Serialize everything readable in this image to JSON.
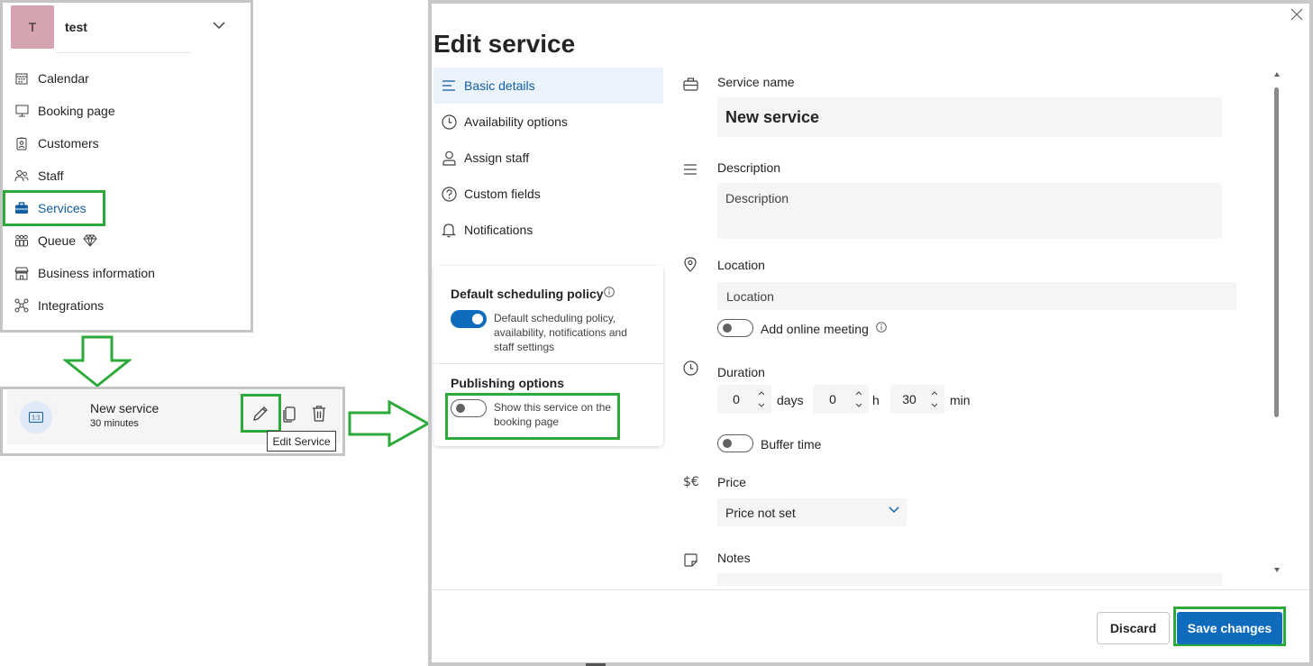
{
  "account": {
    "initial": "T",
    "name": "test"
  },
  "nav": {
    "items": [
      {
        "label": "Calendar",
        "icon": "calendar-icon"
      },
      {
        "label": "Booking page",
        "icon": "monitor-icon"
      },
      {
        "label": "Customers",
        "icon": "contact-card-icon"
      },
      {
        "label": "Staff",
        "icon": "people-icon"
      },
      {
        "label": "Services",
        "icon": "briefcase-icon",
        "active": true
      },
      {
        "label": "Queue",
        "icon": "queue-icon",
        "badge_icon": "diamond-icon"
      },
      {
        "label": "Business information",
        "icon": "building-icon"
      },
      {
        "label": "Integrations",
        "icon": "integrations-icon"
      }
    ]
  },
  "service_card": {
    "icon_text": "1:1",
    "title": "New service",
    "subtitle": "30 minutes",
    "tooltip": "Edit Service"
  },
  "dialog": {
    "title": "Edit service",
    "tabs": [
      {
        "label": "Basic details",
        "icon": "lines-icon",
        "active": true
      },
      {
        "label": "Availability options",
        "icon": "clock-icon"
      },
      {
        "label": "Assign staff",
        "icon": "person-icon"
      },
      {
        "label": "Custom fields",
        "icon": "question-icon"
      },
      {
        "label": "Notifications",
        "icon": "bell-icon"
      }
    ],
    "policy": {
      "title": "Default scheduling policy",
      "toggle_on": true,
      "text": "Default scheduling policy, availability, notifications and staff settings"
    },
    "publishing": {
      "title": "Publishing options",
      "toggle_on": false,
      "text": "Show this service on the booking page"
    },
    "form": {
      "service_name_label": "Service name",
      "service_name_value": "New service",
      "description_label": "Description",
      "description_placeholder": "Description",
      "location_label": "Location",
      "location_placeholder": "Location",
      "online_meeting_label": "Add online meeting",
      "online_meeting_on": false,
      "duration_label": "Duration",
      "duration_days": "0",
      "duration_days_unit": "days",
      "duration_hours": "0",
      "duration_hours_unit": "h",
      "duration_minutes": "30",
      "duration_minutes_unit": "min",
      "buffer_label": "Buffer time",
      "buffer_on": false,
      "price_label": "Price",
      "price_value": "Price not set",
      "notes_label": "Notes"
    },
    "buttons": {
      "discard": "Discard",
      "save": "Save changes"
    }
  },
  "colors": {
    "accent": "#0f6cbd",
    "highlight": "#2eaa3c",
    "avatar": "#d6a3b0"
  }
}
